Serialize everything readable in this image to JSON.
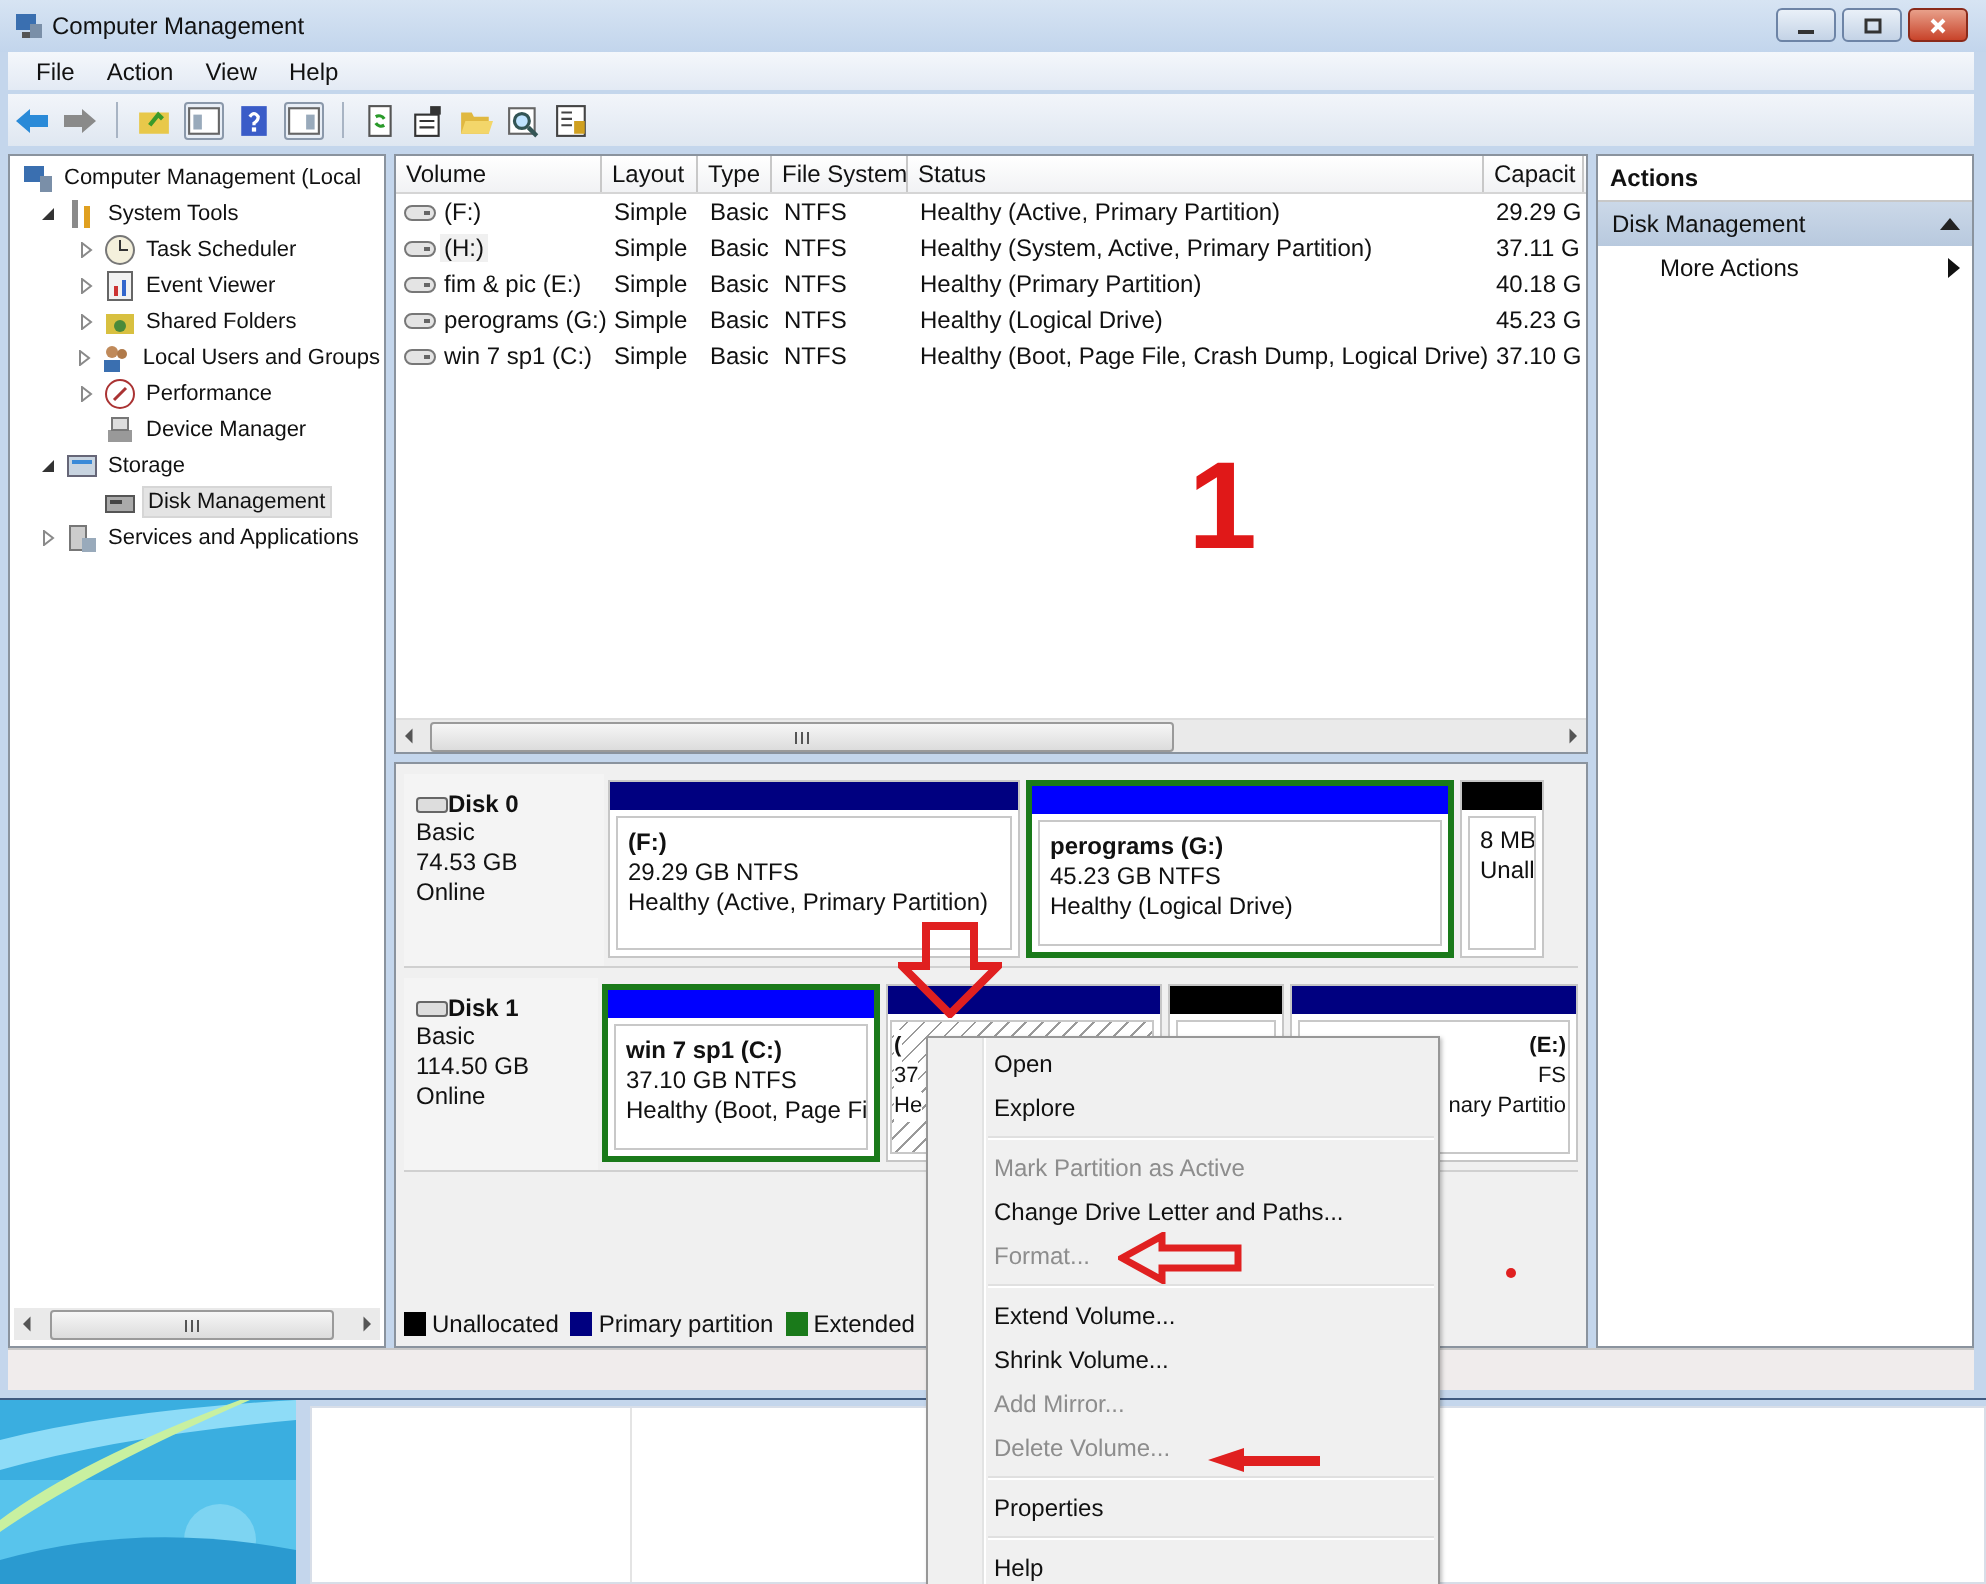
{
  "window": {
    "title": "Computer Management"
  },
  "menu": [
    "File",
    "Action",
    "View",
    "Help"
  ],
  "tree": [
    {
      "label": "Computer Management (Local",
      "selected": false,
      "children": [
        {
          "label": "System Tools",
          "expanded": true,
          "selected": false,
          "children": [
            {
              "label": "Task Scheduler",
              "expanded": false,
              "selected": false
            },
            {
              "label": "Event Viewer",
              "expanded": false,
              "selected": false
            },
            {
              "label": "Shared Folders",
              "expanded": false,
              "selected": false
            },
            {
              "label": "Local Users and Groups",
              "expanded": false,
              "selected": false
            },
            {
              "label": "Performance",
              "expanded": false,
              "selected": false
            },
            {
              "label": "Device Manager",
              "selected": false
            }
          ]
        },
        {
          "label": "Storage",
          "expanded": true,
          "selected": false,
          "children": [
            {
              "label": "Disk Management",
              "selected": true
            }
          ]
        },
        {
          "label": "Services and Applications",
          "expanded": false,
          "selected": false
        }
      ]
    }
  ],
  "volumes": {
    "columns": [
      "Volume",
      "Layout",
      "Type",
      "File System",
      "Status",
      "Capacit"
    ],
    "rows": [
      {
        "volume": "(F:)",
        "layout": "Simple",
        "type": "Basic",
        "file_system": "NTFS",
        "status": "Healthy (Active, Primary Partition)",
        "capacity": "29.29 G",
        "selected": false
      },
      {
        "volume": "(H:)",
        "layout": "Simple",
        "type": "Basic",
        "file_system": "NTFS",
        "status": "Healthy (System, Active, Primary Partition)",
        "capacity": "37.11 G",
        "selected": true
      },
      {
        "volume": "fim  & pic (E:)",
        "layout": "Simple",
        "type": "Basic",
        "file_system": "NTFS",
        "status": "Healthy (Primary Partition)",
        "capacity": "40.18 G",
        "selected": false
      },
      {
        "volume": "perograms (G:)",
        "layout": "Simple",
        "type": "Basic",
        "file_system": "NTFS",
        "status": "Healthy (Logical Drive)",
        "capacity": "45.23 G",
        "selected": false
      },
      {
        "volume": "win 7 sp1 (C:)",
        "layout": "Simple",
        "type": "Basic",
        "file_system": "NTFS",
        "status": "Healthy (Boot, Page File, Crash Dump, Logical Drive)",
        "capacity": "37.10 G",
        "selected": false
      }
    ]
  },
  "annotation_label": "1",
  "disks": [
    {
      "name": "Disk 0",
      "type": "Basic",
      "size": "74.53 GB",
      "state": "Online",
      "partitions": [
        {
          "kind": "primary",
          "name": "(F:)",
          "size_fs": "29.29 GB NTFS",
          "status": "Healthy (Active, Primary Partition)",
          "selected": false
        },
        {
          "kind": "logical",
          "name": "perograms  (G:)",
          "size_fs": "45.23 GB NTFS",
          "status": "Healthy (Logical Drive)",
          "selected": false
        },
        {
          "kind": "unallocated",
          "size_fs": "8 MB",
          "status": "Unall",
          "selected": false
        }
      ]
    },
    {
      "name": "Disk 1",
      "type": "Basic",
      "size": "114.50 GB",
      "state": "Online",
      "partitions": [
        {
          "kind": "logical",
          "name": "win 7 sp1  (C:)",
          "size_fs": "37.10 GB NTFS",
          "status": "Healthy (Boot, Page Fi",
          "selected": false
        },
        {
          "kind": "primary",
          "name": "(",
          "size_fs": "37",
          "status": "He",
          "selected": true
        },
        {
          "kind": "unallocated",
          "selected": false
        },
        {
          "kind": "primary",
          "name": "(E:)",
          "size_fs": "FS",
          "status": "nary Partitio",
          "selected": false,
          "covered": true
        }
      ]
    }
  ],
  "legend": [
    {
      "label": "Unallocated",
      "color": "#000000"
    },
    {
      "label": "Primary partition",
      "color": "#000080"
    },
    {
      "label": "Extended",
      "color": "#1a7a1a"
    }
  ],
  "actions": {
    "title": "Actions",
    "sections": [
      {
        "label": "Disk Management",
        "expanded": true,
        "items": [
          "More Actions"
        ]
      }
    ]
  },
  "context_menu": [
    [
      {
        "label": "Open",
        "disabled": false
      },
      {
        "label": "Explore",
        "disabled": false
      }
    ],
    [
      {
        "label": "Mark Partition as Active",
        "disabled": true
      },
      {
        "label": "Change Drive Letter and Paths...",
        "disabled": false
      },
      {
        "label": "Format...",
        "disabled": true
      }
    ],
    [
      {
        "label": "Extend Volume...",
        "disabled": false
      },
      {
        "label": "Shrink Volume...",
        "disabled": false
      },
      {
        "label": "Add Mirror...",
        "disabled": true
      },
      {
        "label": "Delete Volume...",
        "disabled": true
      }
    ],
    [
      {
        "label": "Properties",
        "disabled": false
      }
    ],
    [
      {
        "label": "Help",
        "disabled": false
      }
    ]
  ]
}
